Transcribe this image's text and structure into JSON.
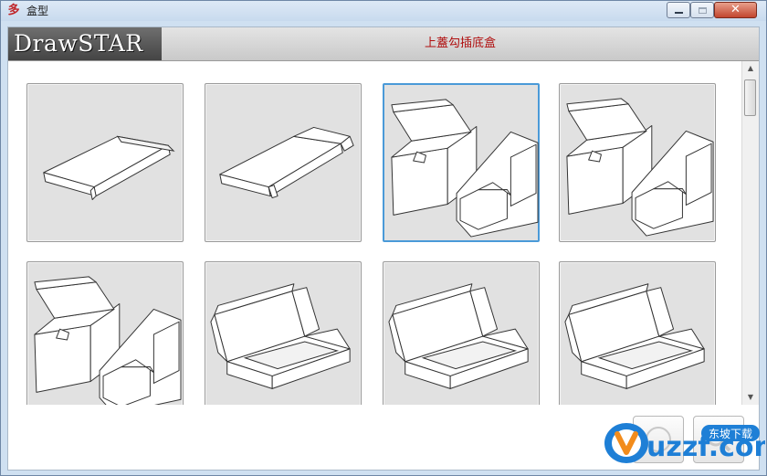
{
  "window": {
    "title": "盒型",
    "app_icon": "drawstar-app-icon",
    "controls": [
      "minimize",
      "maximize",
      "close"
    ],
    "close_symbol": "✕"
  },
  "header": {
    "logo": "DrawSTAR",
    "title": "上蓋勾插底盒"
  },
  "grid": {
    "tiles": [
      {
        "shape": "tray-flat",
        "selected": false
      },
      {
        "shape": "tray-flat-tuck",
        "selected": false
      },
      {
        "shape": "tuck-box-opened",
        "selected": true
      },
      {
        "shape": "tuck-box-opened",
        "selected": false
      },
      {
        "shape": "tuck-box-opened",
        "selected": false
      },
      {
        "shape": "mailer-box",
        "selected": false
      },
      {
        "shape": "mailer-box",
        "selected": false
      },
      {
        "shape": "mailer-box",
        "selected": false
      }
    ]
  },
  "buttons": {
    "ok_icon": "confirm-icon",
    "cancel_icon": "search-icon"
  },
  "watermark": {
    "brand": "uzzf.com",
    "tagline": "东坡下载"
  },
  "colors": {
    "title_text": "#b01010",
    "selection": "#4a9ad8",
    "tile_bg": "#e1e1e1"
  }
}
